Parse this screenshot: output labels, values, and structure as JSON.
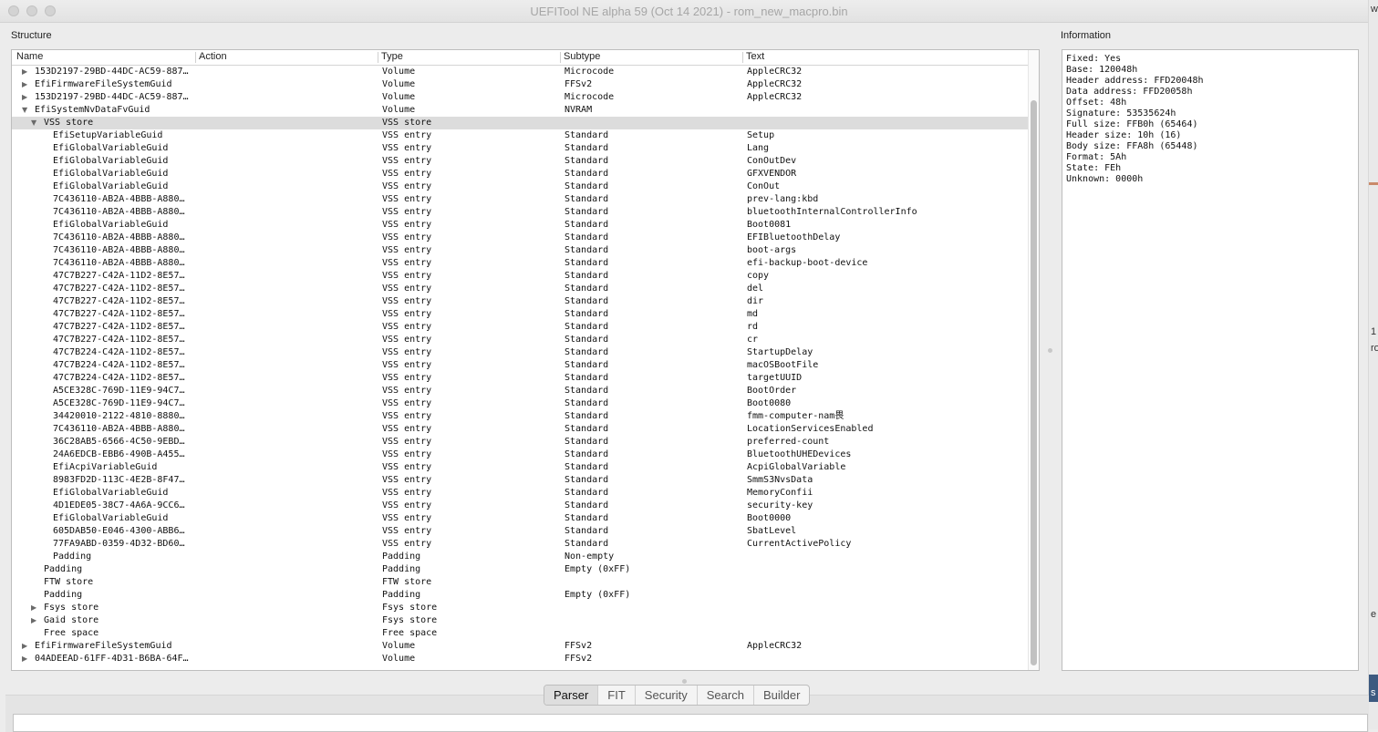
{
  "window": {
    "title": "UEFITool NE alpha 59 (Oct 14 2021) - rom_new_macpro.bin"
  },
  "structure": {
    "label": "Structure",
    "columns": [
      "Name",
      "Action",
      "Type",
      "Subtype",
      "Text"
    ],
    "rows": [
      {
        "indent": 1,
        "arrow": "right",
        "name": "153D2197-29BD-44DC-AC59-887…",
        "action": "",
        "type": "Volume",
        "subtype": "Microcode",
        "text": "AppleCRC32"
      },
      {
        "indent": 1,
        "arrow": "right",
        "name": "EfiFirmwareFileSystemGuid",
        "action": "",
        "type": "Volume",
        "subtype": "FFSv2",
        "text": "AppleCRC32"
      },
      {
        "indent": 1,
        "arrow": "right",
        "name": "153D2197-29BD-44DC-AC59-887…",
        "action": "",
        "type": "Volume",
        "subtype": "Microcode",
        "text": "AppleCRC32"
      },
      {
        "indent": 1,
        "arrow": "down",
        "name": "EfiSystemNvDataFvGuid",
        "action": "",
        "type": "Volume",
        "subtype": "NVRAM",
        "text": ""
      },
      {
        "indent": 2,
        "arrow": "down",
        "name": "VSS store",
        "action": "",
        "type": "VSS store",
        "subtype": "",
        "text": "",
        "selected": true
      },
      {
        "indent": 3,
        "arrow": "",
        "name": "EfiSetupVariableGuid",
        "action": "",
        "type": "VSS entry",
        "subtype": "Standard",
        "text": "Setup"
      },
      {
        "indent": 3,
        "arrow": "",
        "name": "EfiGlobalVariableGuid",
        "action": "",
        "type": "VSS entry",
        "subtype": "Standard",
        "text": "Lang"
      },
      {
        "indent": 3,
        "arrow": "",
        "name": "EfiGlobalVariableGuid",
        "action": "",
        "type": "VSS entry",
        "subtype": "Standard",
        "text": "ConOutDev"
      },
      {
        "indent": 3,
        "arrow": "",
        "name": "EfiGlobalVariableGuid",
        "action": "",
        "type": "VSS entry",
        "subtype": "Standard",
        "text": "GFXVENDOR"
      },
      {
        "indent": 3,
        "arrow": "",
        "name": "EfiGlobalVariableGuid",
        "action": "",
        "type": "VSS entry",
        "subtype": "Standard",
        "text": "ConOut"
      },
      {
        "indent": 3,
        "arrow": "",
        "name": "7C436110-AB2A-4BBB-A880…",
        "action": "",
        "type": "VSS entry",
        "subtype": "Standard",
        "text": "prev-lang:kbd"
      },
      {
        "indent": 3,
        "arrow": "",
        "name": "7C436110-AB2A-4BBB-A880…",
        "action": "",
        "type": "VSS entry",
        "subtype": "Standard",
        "text": "bluetoothInternalControllerInfo"
      },
      {
        "indent": 3,
        "arrow": "",
        "name": "EfiGlobalVariableGuid",
        "action": "",
        "type": "VSS entry",
        "subtype": "Standard",
        "text": "Boot0081"
      },
      {
        "indent": 3,
        "arrow": "",
        "name": "7C436110-AB2A-4BBB-A880…",
        "action": "",
        "type": "VSS entry",
        "subtype": "Standard",
        "text": "EFIBluetoothDelay"
      },
      {
        "indent": 3,
        "arrow": "",
        "name": "7C436110-AB2A-4BBB-A880…",
        "action": "",
        "type": "VSS entry",
        "subtype": "Standard",
        "text": "boot-args"
      },
      {
        "indent": 3,
        "arrow": "",
        "name": "7C436110-AB2A-4BBB-A880…",
        "action": "",
        "type": "VSS entry",
        "subtype": "Standard",
        "text": "efi-backup-boot-device"
      },
      {
        "indent": 3,
        "arrow": "",
        "name": "47C7B227-C42A-11D2-8E57…",
        "action": "",
        "type": "VSS entry",
        "subtype": "Standard",
        "text": "copy"
      },
      {
        "indent": 3,
        "arrow": "",
        "name": "47C7B227-C42A-11D2-8E57…",
        "action": "",
        "type": "VSS entry",
        "subtype": "Standard",
        "text": "del"
      },
      {
        "indent": 3,
        "arrow": "",
        "name": "47C7B227-C42A-11D2-8E57…",
        "action": "",
        "type": "VSS entry",
        "subtype": "Standard",
        "text": "dir"
      },
      {
        "indent": 3,
        "arrow": "",
        "name": "47C7B227-C42A-11D2-8E57…",
        "action": "",
        "type": "VSS entry",
        "subtype": "Standard",
        "text": "md"
      },
      {
        "indent": 3,
        "arrow": "",
        "name": "47C7B227-C42A-11D2-8E57…",
        "action": "",
        "type": "VSS entry",
        "subtype": "Standard",
        "text": "rd"
      },
      {
        "indent": 3,
        "arrow": "",
        "name": "47C7B227-C42A-11D2-8E57…",
        "action": "",
        "type": "VSS entry",
        "subtype": "Standard",
        "text": "cr"
      },
      {
        "indent": 3,
        "arrow": "",
        "name": "47C7B224-C42A-11D2-8E57…",
        "action": "",
        "type": "VSS entry",
        "subtype": "Standard",
        "text": "StartupDelay"
      },
      {
        "indent": 3,
        "arrow": "",
        "name": "47C7B224-C42A-11D2-8E57…",
        "action": "",
        "type": "VSS entry",
        "subtype": "Standard",
        "text": "macOSBootFile"
      },
      {
        "indent": 3,
        "arrow": "",
        "name": "47C7B224-C42A-11D2-8E57…",
        "action": "",
        "type": "VSS entry",
        "subtype": "Standard",
        "text": "targetUUID"
      },
      {
        "indent": 3,
        "arrow": "",
        "name": "A5CE328C-769D-11E9-94C7…",
        "action": "",
        "type": "VSS entry",
        "subtype": "Standard",
        "text": "BootOrder"
      },
      {
        "indent": 3,
        "arrow": "",
        "name": "A5CE328C-769D-11E9-94C7…",
        "action": "",
        "type": "VSS entry",
        "subtype": "Standard",
        "text": "Boot0080"
      },
      {
        "indent": 3,
        "arrow": "",
        "name": "34420010-2122-4810-8880…",
        "action": "",
        "type": "VSS entry",
        "subtype": "Standard",
        "text": "fmm-computer-nam畏"
      },
      {
        "indent": 3,
        "arrow": "",
        "name": "7C436110-AB2A-4BBB-A880…",
        "action": "",
        "type": "VSS entry",
        "subtype": "Standard",
        "text": "LocationServicesEnabled"
      },
      {
        "indent": 3,
        "arrow": "",
        "name": "36C28AB5-6566-4C50-9EBD…",
        "action": "",
        "type": "VSS entry",
        "subtype": "Standard",
        "text": "preferred-count"
      },
      {
        "indent": 3,
        "arrow": "",
        "name": "24A6EDCB-EBB6-490B-A455…",
        "action": "",
        "type": "VSS entry",
        "subtype": "Standard",
        "text": "BluetoothUHEDevices"
      },
      {
        "indent": 3,
        "arrow": "",
        "name": "EfiAcpiVariableGuid",
        "action": "",
        "type": "VSS entry",
        "subtype": "Standard",
        "text": "AcpiGlobalVariable"
      },
      {
        "indent": 3,
        "arrow": "",
        "name": "8983FD2D-113C-4E2B-8F47…",
        "action": "",
        "type": "VSS entry",
        "subtype": "Standard",
        "text": "SmmS3NvsData"
      },
      {
        "indent": 3,
        "arrow": "",
        "name": "EfiGlobalVariableGuid",
        "action": "",
        "type": "VSS entry",
        "subtype": "Standard",
        "text": "MemoryConfii"
      },
      {
        "indent": 3,
        "arrow": "",
        "name": "4D1EDE05-38C7-4A6A-9CC6…",
        "action": "",
        "type": "VSS entry",
        "subtype": "Standard",
        "text": "security-key"
      },
      {
        "indent": 3,
        "arrow": "",
        "name": "EfiGlobalVariableGuid",
        "action": "",
        "type": "VSS entry",
        "subtype": "Standard",
        "text": "Boot0000"
      },
      {
        "indent": 3,
        "arrow": "",
        "name": "605DAB50-E046-4300-ABB6…",
        "action": "",
        "type": "VSS entry",
        "subtype": "Standard",
        "text": "SbatLevel"
      },
      {
        "indent": 3,
        "arrow": "",
        "name": "77FA9ABD-0359-4D32-BD60…",
        "action": "",
        "type": "VSS entry",
        "subtype": "Standard",
        "text": "CurrentActivePolicy"
      },
      {
        "indent": 3,
        "arrow": "",
        "name": "Padding",
        "action": "",
        "type": "Padding",
        "subtype": "Non-empty",
        "text": ""
      },
      {
        "indent": 2,
        "arrow": "",
        "name": "Padding",
        "action": "",
        "type": "Padding",
        "subtype": "Empty (0xFF)",
        "text": ""
      },
      {
        "indent": 2,
        "arrow": "",
        "name": "FTW store",
        "action": "",
        "type": "FTW store",
        "subtype": "",
        "text": ""
      },
      {
        "indent": 2,
        "arrow": "",
        "name": "Padding",
        "action": "",
        "type": "Padding",
        "subtype": "Empty (0xFF)",
        "text": ""
      },
      {
        "indent": 2,
        "arrow": "right",
        "name": "Fsys store",
        "action": "",
        "type": "Fsys store",
        "subtype": "",
        "text": ""
      },
      {
        "indent": 2,
        "arrow": "right",
        "name": "Gaid store",
        "action": "",
        "type": "Fsys store",
        "subtype": "",
        "text": ""
      },
      {
        "indent": 2,
        "arrow": "",
        "name": "Free space",
        "action": "",
        "type": "Free space",
        "subtype": "",
        "text": ""
      },
      {
        "indent": 1,
        "arrow": "right",
        "name": "EfiFirmwareFileSystemGuid",
        "action": "",
        "type": "Volume",
        "subtype": "FFSv2",
        "text": "AppleCRC32"
      },
      {
        "indent": 1,
        "arrow": "right",
        "name": "04ADEEAD-61FF-4D31-B6BA-64F…",
        "action": "",
        "type": "Volume",
        "subtype": "FFSv2",
        "text": ""
      }
    ]
  },
  "information": {
    "label": "Information",
    "lines": [
      "Fixed: Yes",
      "Base: 120048h",
      "Header address: FFD20048h",
      "Data address: FFD20058h",
      "Offset: 48h",
      "Signature: 53535624h",
      "Full size: FFB0h (65464)",
      "Header size: 10h (16)",
      "Body size: FFA8h (65448)",
      "Format: 5Ah",
      "State: FEh",
      "Unknown: 0000h"
    ]
  },
  "tabs": [
    {
      "label": "Parser",
      "active": true
    },
    {
      "label": "FIT",
      "active": false
    },
    {
      "label": "Security",
      "active": false
    },
    {
      "label": "Search",
      "active": false
    },
    {
      "label": "Builder",
      "active": false
    }
  ],
  "arrows": {
    "right": "▶",
    "down": "▼"
  },
  "edge_fragments": [
    "w",
    "1",
    "ro",
    "e",
    "s"
  ]
}
